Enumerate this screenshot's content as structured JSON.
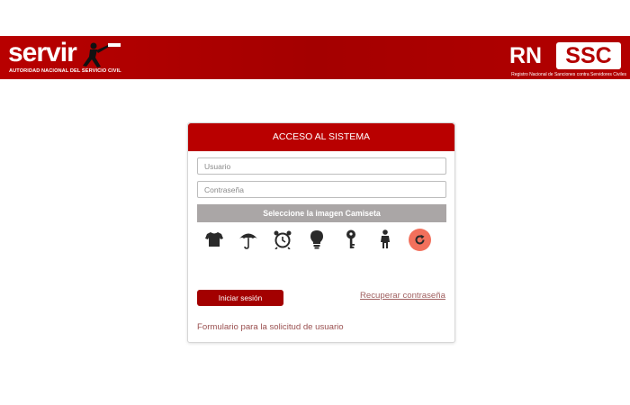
{
  "header": {
    "left_brand": {
      "word": "servir",
      "subtitle": "AUTORIDAD NACIONAL DEL SERVICIO CIVIL"
    },
    "right_brand": {
      "letters_left": "RN",
      "letters_boxed": "SSC",
      "subtitle": "Registro Nacional de Sanciones contra Servidores Civiles"
    },
    "colors": {
      "bar": "#b00000",
      "text": "#ffffff"
    }
  },
  "login": {
    "title": "ACCESO AL SISTEMA",
    "username_placeholder": "Usuario",
    "password_placeholder": "Contraseña",
    "captcha_prompt": "Seleccione la imagen ",
    "captcha_target": "Camiseta",
    "captcha_icons": [
      "tshirt-icon",
      "umbrella-icon",
      "alarm-clock-icon",
      "lightbulb-icon",
      "key-icon",
      "person-icon",
      "refresh-icon"
    ],
    "submit_label": "Iniciar sesión",
    "recover_label": "Recuperar contraseña",
    "request_form_label": "Formulario para la solicitud de usuario",
    "colors": {
      "accent": "#b90000",
      "button": "#a30000",
      "captcha_bar": "#aaa6a6",
      "refresh": "#f2705c",
      "link": "#a06060"
    }
  }
}
